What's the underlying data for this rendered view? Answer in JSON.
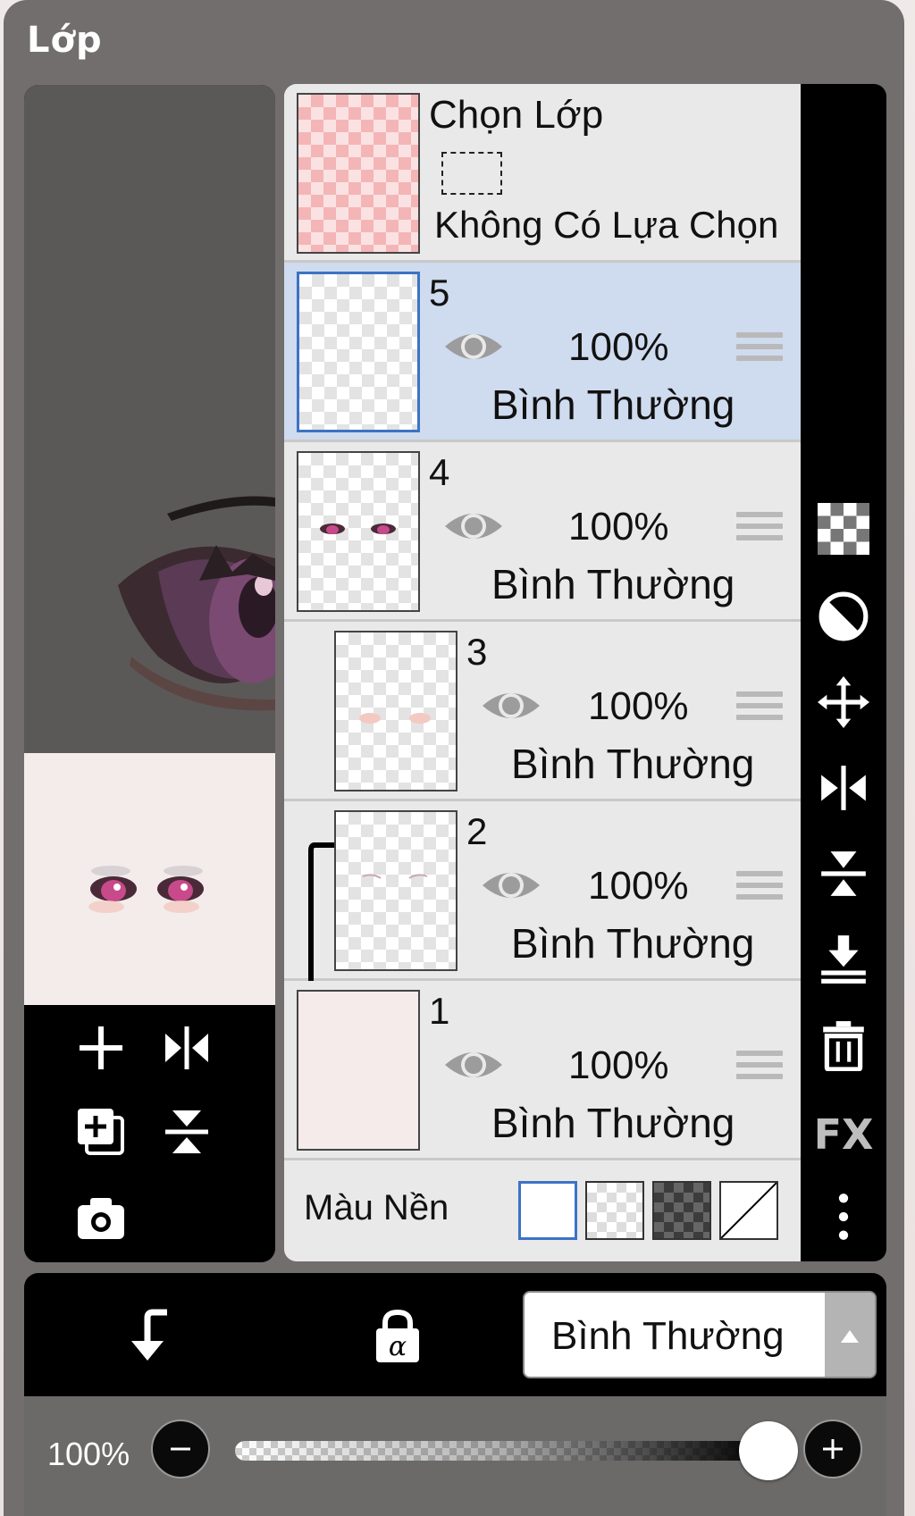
{
  "panel": {
    "title": "Lớp"
  },
  "selection_layer": {
    "title": "Chọn Lớp",
    "status": "Không Có Lựa Chọn"
  },
  "layers": [
    {
      "number": "5",
      "opacity": "100%",
      "blend": "Bình Thường",
      "visible": true,
      "active": true
    },
    {
      "number": "4",
      "opacity": "100%",
      "blend": "Bình Thường",
      "visible": true,
      "active": false
    },
    {
      "number": "3",
      "opacity": "100%",
      "blend": "Bình Thường",
      "visible": true,
      "active": false,
      "clipped": true
    },
    {
      "number": "2",
      "opacity": "100%",
      "blend": "Bình Thường",
      "visible": true,
      "active": false,
      "clipped": true
    },
    {
      "number": "1",
      "opacity": "100%",
      "blend": "Bình Thường",
      "visible": true,
      "active": false
    }
  ],
  "background": {
    "label": "Màu Nền",
    "options": [
      "white",
      "transparent",
      "dark-checker",
      "none"
    ],
    "selected": "white"
  },
  "left_tools": [
    "add-layer-icon",
    "flip-horizontal-icon",
    "duplicate-layer-icon",
    "flip-vertical-icon",
    "camera-icon"
  ],
  "right_tools": [
    "transparency-icon",
    "half-fill-icon",
    "move-icon",
    "flip-horizontal-icon",
    "flip-vertical-icon",
    "merge-down-icon",
    "trash-icon",
    "fx-icon",
    "more-vertical-icon"
  ],
  "right_toolbar": {
    "fx_label": "FX"
  },
  "bottom": {
    "blend_mode": "Bình Thường",
    "clip_icon": "clip-arrow-icon",
    "alpha_lock_icon": "alpha-lock-icon"
  },
  "opacity_bar": {
    "label": "100%",
    "value": 1.0
  },
  "colors": {
    "active_layer": "#cfdbee",
    "accent_blue": "#3c73c4",
    "panel_gray": "#716e6d"
  }
}
